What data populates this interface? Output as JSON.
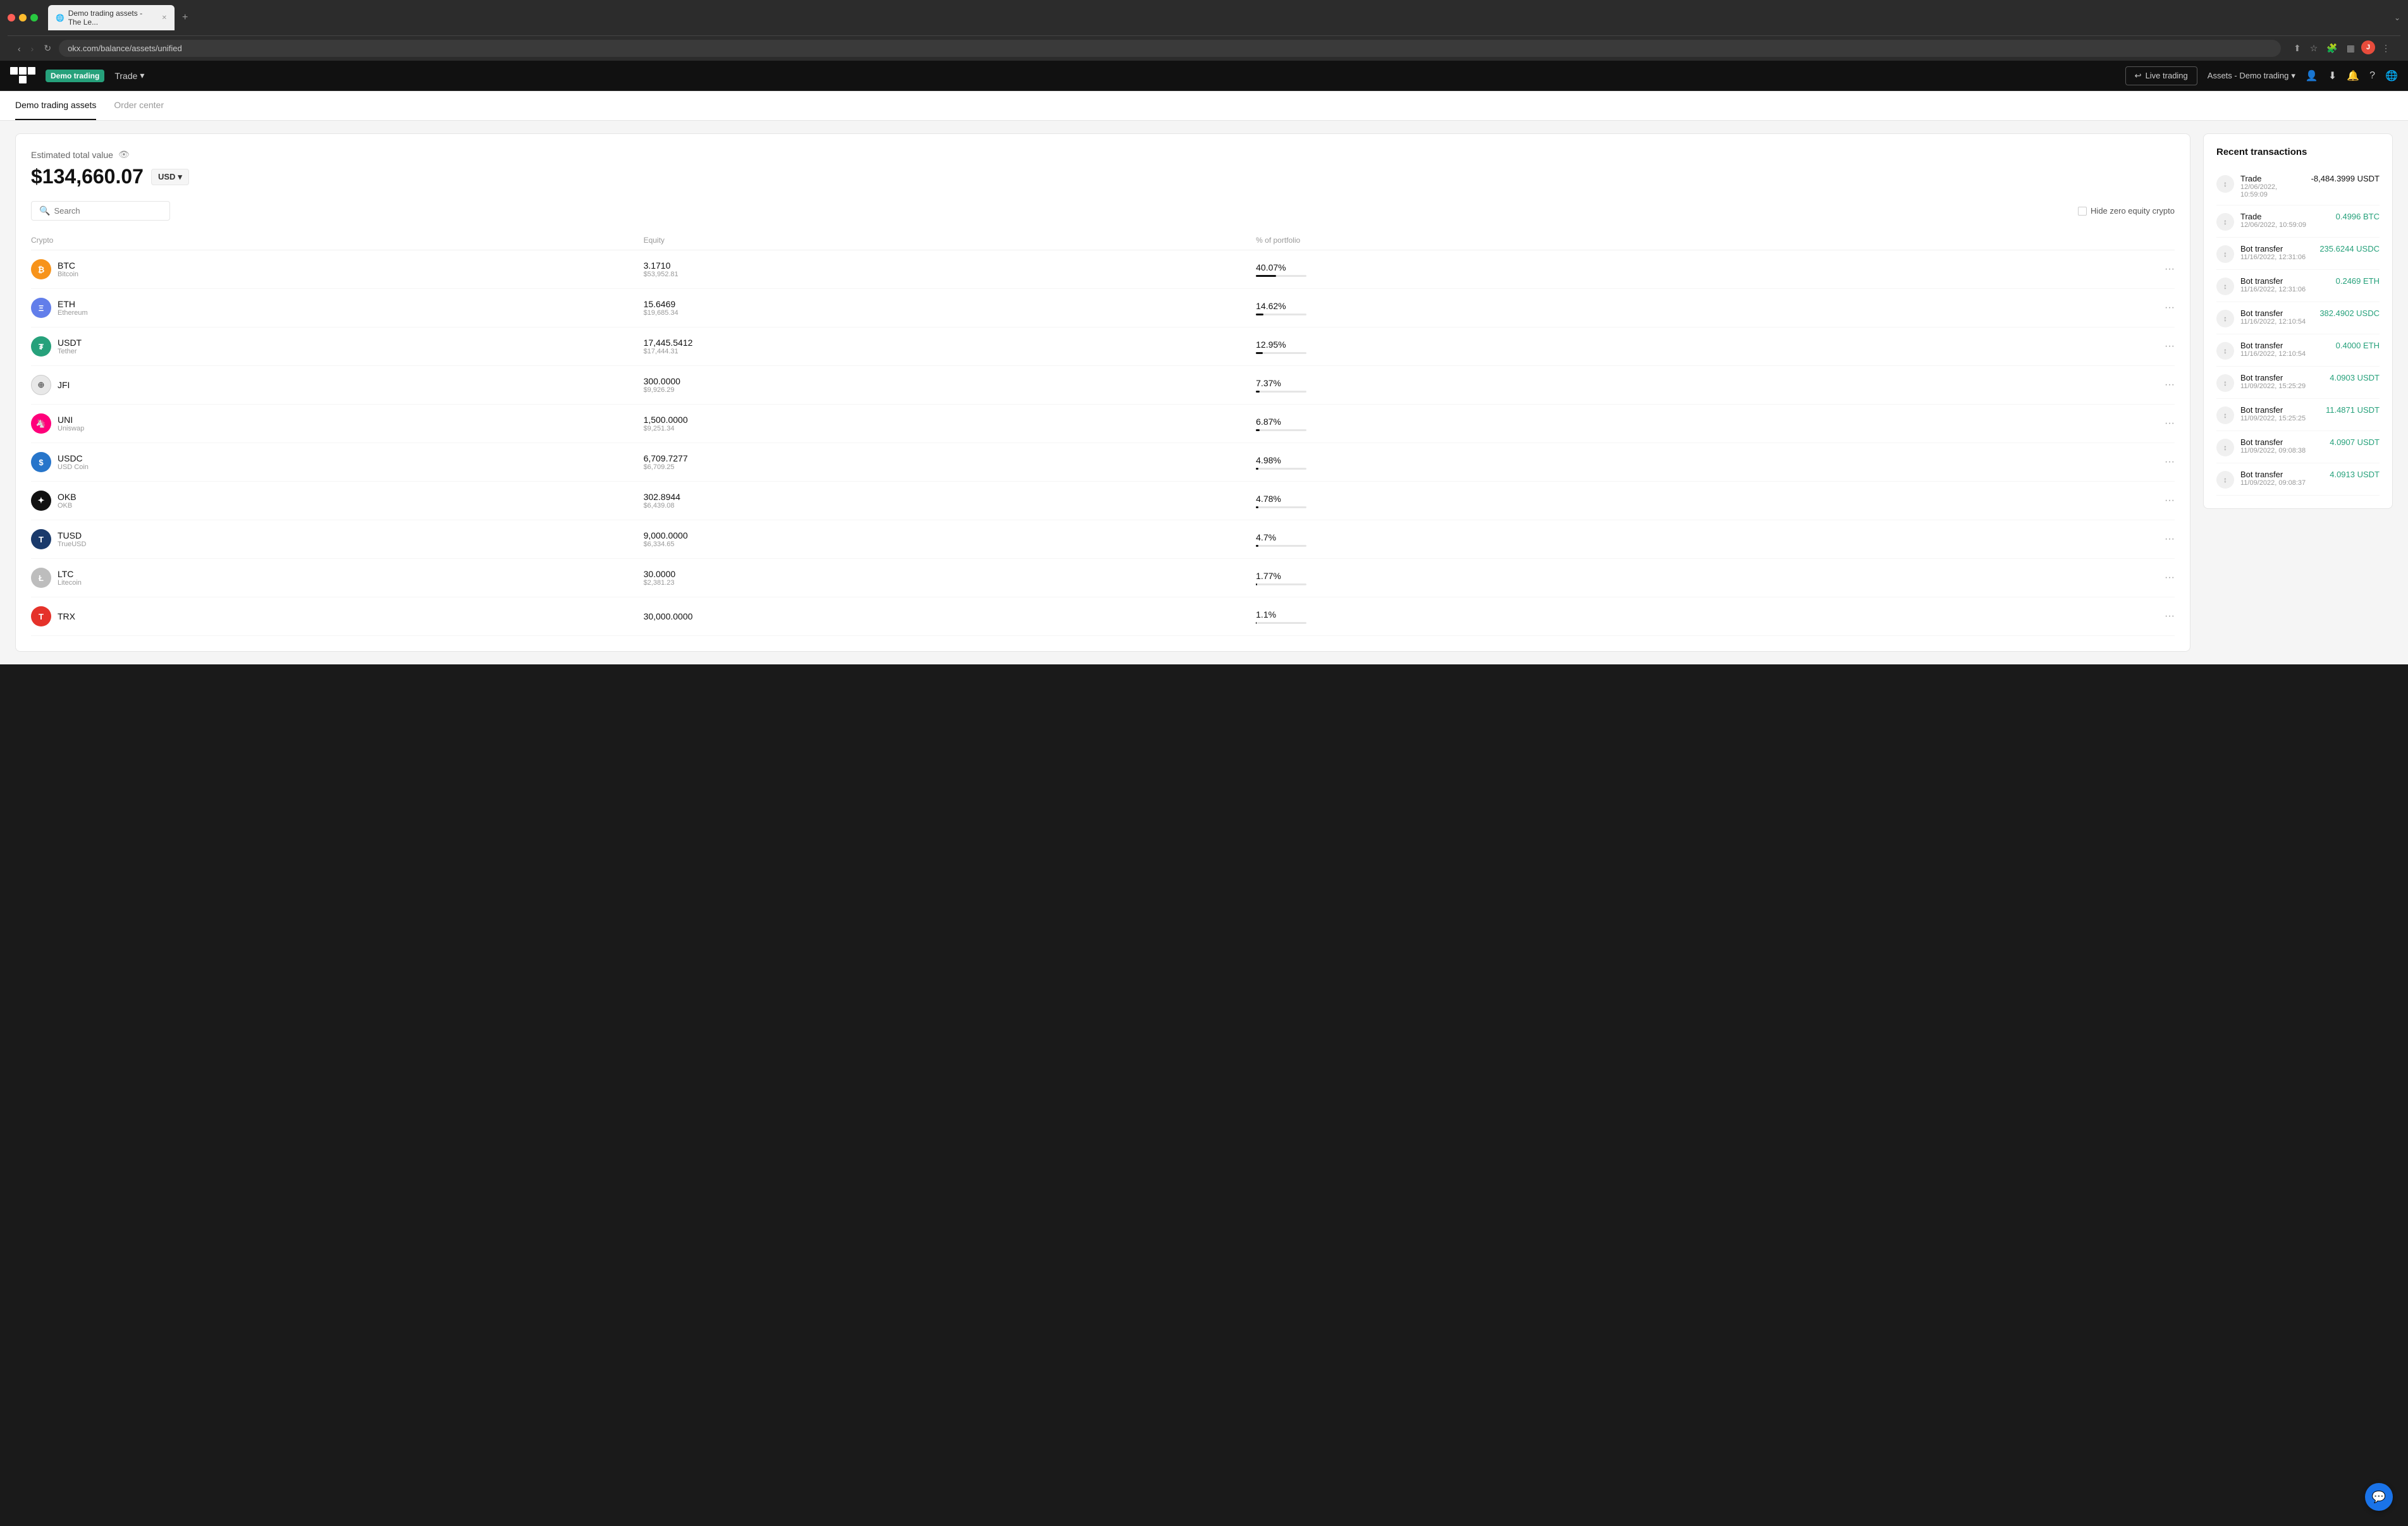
{
  "browser": {
    "tab_title": "Demo trading assets - The Le...",
    "url": "okx.com/balance/assets/unified",
    "new_tab_label": "+",
    "window_expand": "⌄"
  },
  "nav": {
    "demo_badge": "Demo trading",
    "trade_menu": "Trade",
    "live_trading_btn": "Live trading",
    "assets_dropdown": "Assets - Demo trading",
    "arrow": "›"
  },
  "page_tabs": [
    {
      "label": "Demo trading assets",
      "active": true
    },
    {
      "label": "Order center",
      "active": false
    }
  ],
  "main": {
    "estimated_label": "Estimated total value",
    "total_value": "$134,660.07",
    "currency": "USD",
    "search_placeholder": "Search",
    "hide_zero_label": "Hide zero equity crypto",
    "table_headers": {
      "crypto": "Crypto",
      "equity": "Equity",
      "portfolio": "% of portfolio"
    },
    "assets": [
      {
        "symbol": "BTC",
        "name": "Bitcoin",
        "equity": "3.1710",
        "usd": "$53,952.81",
        "pct": "40.07%",
        "pct_num": 40.07,
        "icon_class": "btc-icon",
        "icon_text": "₿"
      },
      {
        "symbol": "ETH",
        "name": "Ethereum",
        "equity": "15.6469",
        "usd": "$19,685.34",
        "pct": "14.62%",
        "pct_num": 14.62,
        "icon_class": "eth-icon",
        "icon_text": "Ξ"
      },
      {
        "symbol": "USDT",
        "name": "Tether",
        "equity": "17,445.5412",
        "usd": "$17,444.31",
        "pct": "12.95%",
        "pct_num": 12.95,
        "icon_class": "usdt-icon",
        "icon_text": "₮"
      },
      {
        "symbol": "JFI",
        "name": "",
        "equity": "300.0000",
        "usd": "$9,926.29",
        "pct": "7.37%",
        "pct_num": 7.37,
        "icon_class": "jfi-icon",
        "icon_text": "⊕"
      },
      {
        "symbol": "UNI",
        "name": "Uniswap",
        "equity": "1,500.0000",
        "usd": "$9,251.34",
        "pct": "6.87%",
        "pct_num": 6.87,
        "icon_class": "uni-icon",
        "icon_text": "🦄"
      },
      {
        "symbol": "USDC",
        "name": "USD Coin",
        "equity": "6,709.7277",
        "usd": "$6,709.25",
        "pct": "4.98%",
        "pct_num": 4.98,
        "icon_class": "usdc-icon",
        "icon_text": "$"
      },
      {
        "symbol": "OKB",
        "name": "OKB",
        "equity": "302.8944",
        "usd": "$6,439.08",
        "pct": "4.78%",
        "pct_num": 4.78,
        "icon_class": "okb-icon",
        "icon_text": "✦"
      },
      {
        "symbol": "TUSD",
        "name": "TrueUSD",
        "equity": "9,000.0000",
        "usd": "$6,334.65",
        "pct": "4.7%",
        "pct_num": 4.7,
        "icon_class": "tusd-icon",
        "icon_text": "T"
      },
      {
        "symbol": "LTC",
        "name": "Litecoin",
        "equity": "30.0000",
        "usd": "$2,381.23",
        "pct": "1.77%",
        "pct_num": 1.77,
        "icon_class": "ltc-icon",
        "icon_text": "Ł"
      },
      {
        "symbol": "TRX",
        "name": "",
        "equity": "30,000.0000",
        "usd": "",
        "pct": "1.1%",
        "pct_num": 1.1,
        "icon_class": "trx-icon",
        "icon_text": "T"
      }
    ]
  },
  "right_panel": {
    "title": "Recent transactions",
    "transactions": [
      {
        "type": "Trade",
        "date": "12/06/2022, 10:59:09",
        "amount": "-8,484.3999 USDT",
        "positive": false
      },
      {
        "type": "Trade",
        "date": "12/06/2022, 10:59:09",
        "amount": "0.4996 BTC",
        "positive": true
      },
      {
        "type": "Bot transfer",
        "date": "11/16/2022, 12:31:06",
        "amount": "235.6244 USDC",
        "positive": true
      },
      {
        "type": "Bot transfer",
        "date": "11/16/2022, 12:31:06",
        "amount": "0.2469 ETH",
        "positive": true
      },
      {
        "type": "Bot transfer",
        "date": "11/16/2022, 12:10:54",
        "amount": "382.4902 USDC",
        "positive": true
      },
      {
        "type": "Bot transfer",
        "date": "11/16/2022, 12:10:54",
        "amount": "0.4000 ETH",
        "positive": true
      },
      {
        "type": "Bot transfer",
        "date": "11/09/2022, 15:25:29",
        "amount": "4.0903 USDT",
        "positive": true
      },
      {
        "type": "Bot transfer",
        "date": "11/09/2022, 15:25:25",
        "amount": "11.4871 USDT",
        "positive": true
      },
      {
        "type": "Bot transfer",
        "date": "11/09/2022, 09:08:38",
        "amount": "4.0907 USDT",
        "positive": true
      },
      {
        "type": "Bot transfer",
        "date": "11/09/2022, 09:08:37",
        "amount": "4.0913 USDT",
        "positive": true
      }
    ]
  }
}
